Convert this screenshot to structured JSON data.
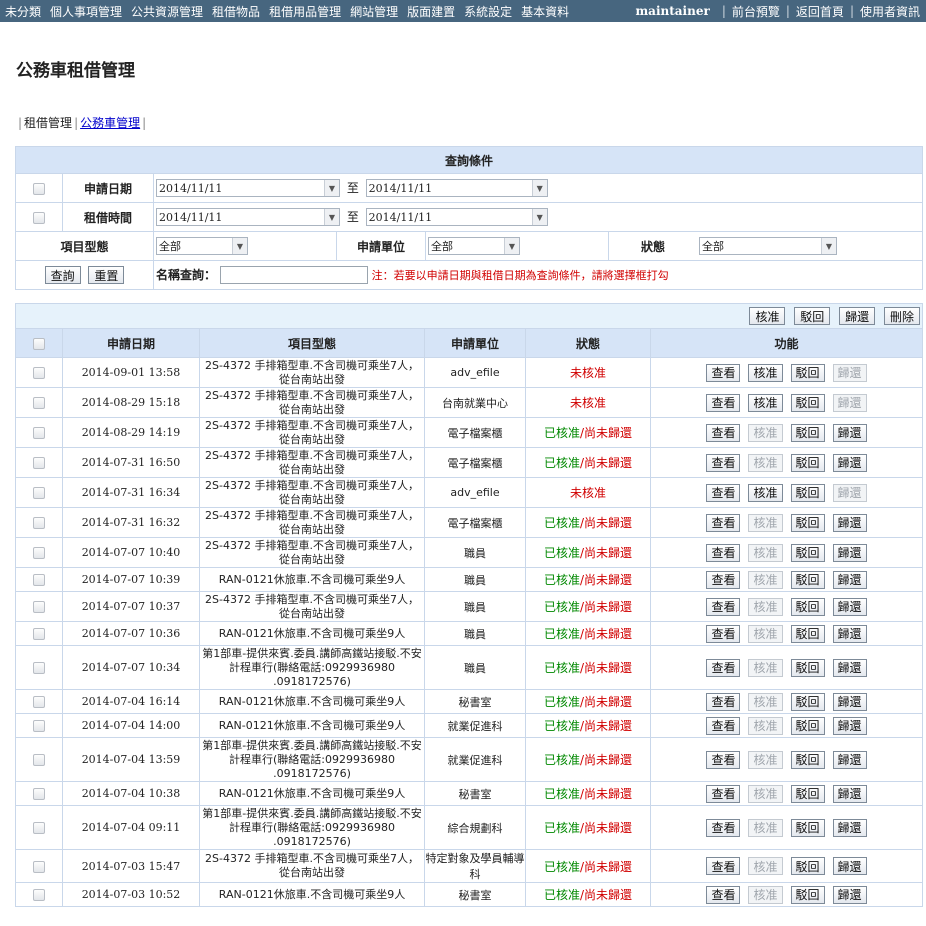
{
  "topnav": {
    "menu": [
      "未分類",
      "個人事項管理",
      "公共資源管理",
      "租借物品",
      "租借用品管理",
      "網站管理",
      "版面建置",
      "系統設定",
      "基本資料"
    ],
    "user": "maintainer",
    "links": [
      "前台預覽",
      "返回首頁",
      "使用者資訊"
    ]
  },
  "page_title": "公務車租借管理",
  "subnav": {
    "item1": "租借管理",
    "item2": "公務車管理"
  },
  "query": {
    "title": "查詢條件",
    "apply_date_label": "申請日期",
    "apply_from": "2014/11/11",
    "apply_to": "2014/11/11",
    "to_label": "至",
    "rent_time_label": "租借時間",
    "rent_from": "2014/11/11",
    "rent_to": "2014/11/11",
    "type_label": "項目型態",
    "type_value": "全部",
    "unit_label": "申請單位",
    "unit_value": "全部",
    "status_label": "狀態",
    "status_value": "全部",
    "search_btn": "查詢",
    "reset_btn": "重置",
    "name_label": "名稱查詢：",
    "name_value": "",
    "note": "注：若要以申請日期與租借日期為查詢條件，請將選擇框打勾"
  },
  "toolbar": {
    "approve": "核准",
    "reject": "駁回",
    "return": "歸還",
    "delete": "刪除"
  },
  "columns": {
    "date": "申請日期",
    "type": "項目型態",
    "unit": "申請單位",
    "status": "狀態",
    "function": "功能"
  },
  "actions": {
    "view": "查看",
    "approve": "核准",
    "reject": "駁回",
    "return": "歸還"
  },
  "status_text": {
    "pending": "未核准",
    "approved": "已核准",
    "slash": "/",
    "not_returned": "尚未歸還"
  },
  "rows": [
    {
      "date": "2014-09-01 13:58",
      "type": "2S-4372 手排箱型車.不含司機可乘坐7人，從台南站出發",
      "unit": "adv_efile",
      "status": "pending"
    },
    {
      "date": "2014-08-29 15:18",
      "type": "2S-4372 手排箱型車.不含司機可乘坐7人，從台南站出發",
      "unit": "台南就業中心",
      "status": "pending"
    },
    {
      "date": "2014-08-29 14:19",
      "type": "2S-4372 手排箱型車.不含司機可乘坐7人，從台南站出發",
      "unit": "電子檔案櫃",
      "status": "approved"
    },
    {
      "date": "2014-07-31 16:50",
      "type": "2S-4372 手排箱型車.不含司機可乘坐7人，從台南站出發",
      "unit": "電子檔案櫃",
      "status": "approved"
    },
    {
      "date": "2014-07-31 16:34",
      "type": "2S-4372 手排箱型車.不含司機可乘坐7人，從台南站出發",
      "unit": "adv_efile",
      "status": "pending"
    },
    {
      "date": "2014-07-31 16:32",
      "type": "2S-4372 手排箱型車.不含司機可乘坐7人，從台南站出發",
      "unit": "電子檔案櫃",
      "status": "approved"
    },
    {
      "date": "2014-07-07 10:40",
      "type": "2S-4372 手排箱型車.不含司機可乘坐7人，從台南站出發",
      "unit": "職員",
      "status": "approved"
    },
    {
      "date": "2014-07-07 10:39",
      "type": "RAN-0121休旅車.不含司機可乘坐9人",
      "unit": "職員",
      "status": "approved"
    },
    {
      "date": "2014-07-07 10:37",
      "type": "2S-4372 手排箱型車.不含司機可乘坐7人，從台南站出發",
      "unit": "職員",
      "status": "approved"
    },
    {
      "date": "2014-07-07 10:36",
      "type": "RAN-0121休旅車.不含司機可乘坐9人",
      "unit": "職員",
      "status": "approved"
    },
    {
      "date": "2014-07-07 10:34",
      "type": "第1部車-提供來賓.委員.講師高鐵站接駁.不安計程車行(聯絡電話:0929936980 .0918172576)",
      "unit": "職員",
      "status": "approved"
    },
    {
      "date": "2014-07-04 16:14",
      "type": "RAN-0121休旅車.不含司機可乘坐9人",
      "unit": "秘書室",
      "status": "approved"
    },
    {
      "date": "2014-07-04 14:00",
      "type": "RAN-0121休旅車.不含司機可乘坐9人",
      "unit": "就業促進科",
      "status": "approved"
    },
    {
      "date": "2014-07-04 13:59",
      "type": "第1部車-提供來賓.委員.講師高鐵站接駁.不安計程車行(聯絡電話:0929936980 .0918172576)",
      "unit": "就業促進科",
      "status": "approved"
    },
    {
      "date": "2014-07-04 10:38",
      "type": "RAN-0121休旅車.不含司機可乘坐9人",
      "unit": "秘書室",
      "status": "approved"
    },
    {
      "date": "2014-07-04 09:11",
      "type": "第1部車-提供來賓.委員.講師高鐵站接駁.不安計程車行(聯絡電話:0929936980 .0918172576)",
      "unit": "綜合規劃科",
      "status": "approved"
    },
    {
      "date": "2014-07-03 15:47",
      "type": "2S-4372 手排箱型車.不含司機可乘坐7人，從台南站出發",
      "unit": "特定對象及學員輔導科",
      "status": "approved"
    },
    {
      "date": "2014-07-03 10:52",
      "type": "RAN-0121休旅車.不含司機可乘坐9人",
      "unit": "秘書室",
      "status": "approved"
    }
  ]
}
